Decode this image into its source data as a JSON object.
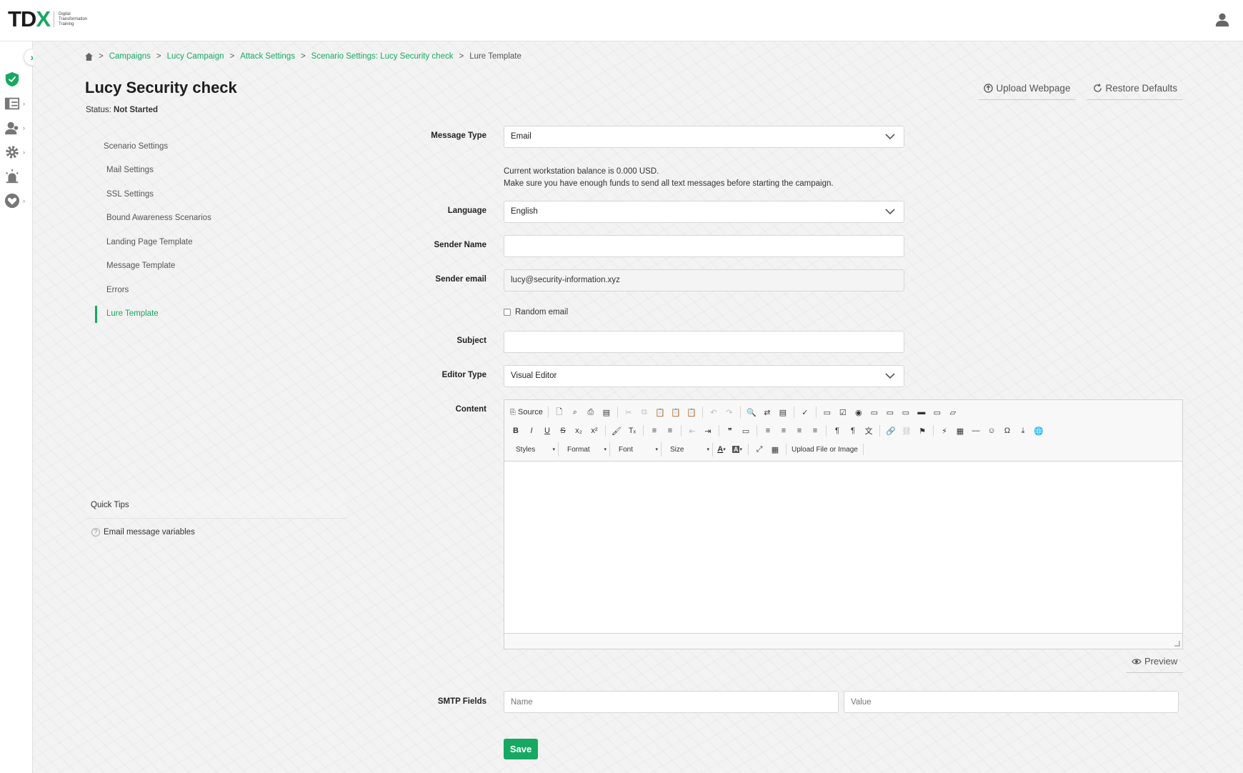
{
  "app": {
    "logo_main": "TD",
    "logo_x": "X",
    "logo_tagline": [
      "Digital",
      "Transformation",
      "Training"
    ],
    "user_icon": "user-icon",
    "accent_color": "#17a862"
  },
  "rail": {
    "toggle_label": "›",
    "items": [
      {
        "icon": "shield-icon",
        "chevron": ""
      },
      {
        "icon": "dashboard-icon",
        "chevron": "›"
      },
      {
        "icon": "users-icon",
        "chevron": "›"
      },
      {
        "icon": "gear-icon",
        "chevron": "›"
      },
      {
        "icon": "alarm-icon",
        "chevron": ""
      },
      {
        "icon": "heart-icon",
        "chevron": "›"
      }
    ]
  },
  "breadcrumb": {
    "home_icon": "home-icon",
    "separator": ">",
    "links": [
      "Campaigns",
      "Lucy Campaign",
      "Attack Settings",
      "Scenario Settings: Lucy Security check"
    ],
    "current": "Lure Template"
  },
  "page": {
    "title": "Lucy Security check",
    "status_label": "Status:",
    "status_value": "Not Started"
  },
  "actions": {
    "upload_webpage": "Upload Webpage",
    "restore_defaults": "Restore Defaults",
    "preview": "Preview",
    "save": "Save"
  },
  "sidenav": {
    "heading": "Scenario Settings",
    "items": [
      {
        "label": "Mail Settings",
        "active": false
      },
      {
        "label": "SSL Settings",
        "active": false
      },
      {
        "label": "Bound Awareness Scenarios",
        "active": false
      },
      {
        "label": "Landing Page Template",
        "active": false
      },
      {
        "label": "Message Template",
        "active": false
      },
      {
        "label": "Errors",
        "active": false
      },
      {
        "label": "Lure Template",
        "active": true
      }
    ]
  },
  "quick_tips": {
    "heading": "Quick Tips",
    "item": "Email message variables"
  },
  "form": {
    "message_type_label": "Message Type",
    "message_type_value": "Email",
    "balance_note_1": "Current workstation balance is 0.000 USD.",
    "balance_note_2": "Make sure you have enough funds to send all text messages before starting the campaign.",
    "language_label": "Language",
    "language_value": "English",
    "sender_name_label": "Sender Name",
    "sender_name_value": "",
    "sender_email_label": "Sender email",
    "sender_email_value": "lucy@security-information.xyz",
    "random_email_label": "Random email",
    "random_email_checked": false,
    "subject_label": "Subject",
    "subject_value": "",
    "editor_type_label": "Editor Type",
    "editor_type_value": "Visual Editor",
    "content_label": "Content",
    "smtp_fields_label": "SMTP Fields",
    "smtp_name_placeholder": "Name",
    "smtp_value_placeholder": "Value"
  },
  "editor_toolbar": {
    "source_label": "Source",
    "styles_label": "Styles",
    "format_label": "Format",
    "font_label": "Font",
    "size_label": "Size",
    "upload_label": "Upload File or Image",
    "combo_arrow": "▾",
    "bold": "B",
    "italic": "I",
    "underline": "U",
    "strike": "S",
    "subscript": "x₂",
    "superscript": "x²",
    "quote": "❞",
    "omega": "Ω",
    "row1_icons": [
      "new-page-icon",
      "preview-icon",
      "print-icon",
      "templates-icon",
      "cut-icon",
      "copy-icon",
      "paste-icon",
      "paste-text-icon",
      "paste-word-icon",
      "undo-icon",
      "redo-icon",
      "find-icon",
      "replace-icon",
      "select-all-icon",
      "spellcheck-icon",
      "form-icon",
      "checkbox-icon",
      "radio-icon",
      "textfield-icon",
      "textarea-icon",
      "select-icon",
      "button-icon",
      "image-button-icon",
      "hidden-field-icon"
    ],
    "row2_icons": [
      "copy-format-icon",
      "remove-format-icon",
      "numbered-list-icon",
      "bullet-list-icon",
      "outdent-icon",
      "indent-icon",
      "div-icon",
      "align-left-icon",
      "align-center-icon",
      "align-right-icon",
      "justify-icon",
      "ltr-icon",
      "rtl-icon",
      "language-icon",
      "link-icon",
      "unlink-icon",
      "anchor-icon",
      "flash-icon",
      "table-icon",
      "horizontal-line-icon",
      "smiley-icon",
      "page-break-icon",
      "iframe-icon"
    ],
    "row3_icons": [
      "text-color-icon",
      "background-color-icon",
      "maximize-icon",
      "show-blocks-icon"
    ]
  }
}
